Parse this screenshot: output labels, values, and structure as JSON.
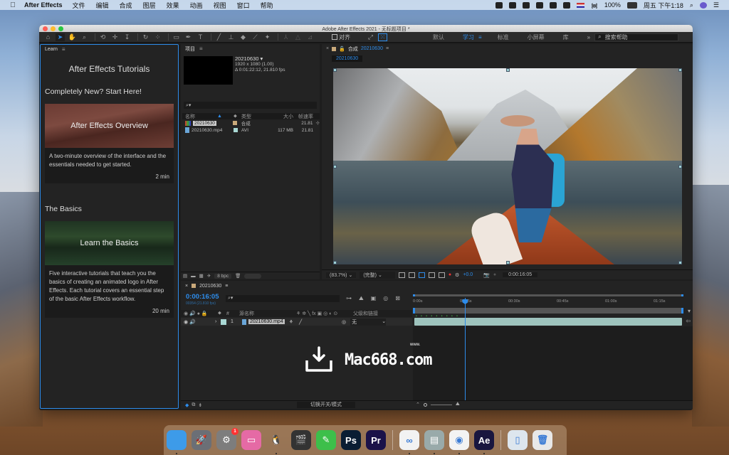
{
  "menubar": {
    "app_name": "After Effects",
    "items": [
      "文件",
      "编辑",
      "合成",
      "图层",
      "效果",
      "动画",
      "视图",
      "窗口",
      "帮助"
    ],
    "battery": "100%",
    "clock": "周五 下午1:18"
  },
  "window": {
    "title": "Adobe After Effects 2021 - 无标题项目 *"
  },
  "toolbar": {
    "snap_label": "对齐",
    "workspaces": [
      "默认",
      "学习",
      "标准",
      "小屏幕",
      "库"
    ],
    "active_workspace": "学习",
    "more": "»",
    "help_placeholder": "搜索帮助"
  },
  "learn": {
    "tab": "Learn",
    "title": "After Effects Tutorials",
    "sections": [
      {
        "heading": "Completely New? Start Here!",
        "card_title": "After Effects Overview",
        "description": "A two-minute overview of the interface and the essentials needed to get started.",
        "duration": "2 min"
      },
      {
        "heading": "The Basics",
        "card_title": "Learn the Basics",
        "description": "Five interactive tutorials that teach you the basics of creating an animated logo in After Effects. Each tutorial covers an essential step of the basic After Effects workflow.",
        "duration": "20 min"
      }
    ]
  },
  "project": {
    "tab": "项目",
    "preview": {
      "name": "20210630 ▾",
      "resolution": "1920 x 1080 (1.00)",
      "duration": "Δ 0:01:22:12, 21.810 fps"
    },
    "search_placeholder": "",
    "columns": [
      "名称",
      "类型",
      "大小",
      "帧速率"
    ],
    "rows": [
      {
        "name": "20210630",
        "type": "合成",
        "size": "",
        "fps": "21.81",
        "tag_color": "#c9a97a"
      },
      {
        "name": "20210630.mp4",
        "type": "AVI",
        "size": "117 MB",
        "fps": "21.81",
        "tag_color": "#a9d8d4"
      }
    ],
    "bpc": "8 bpc"
  },
  "composition": {
    "tab_prefix": "合成",
    "tab_name": "20210630",
    "flow_label": "20210630",
    "zoom": "(83.7%)",
    "resolution": "(完整)",
    "exposure": "+0.0",
    "timecode": "0:00:16:05"
  },
  "timeline": {
    "tab": "20210630",
    "timecode": "0:00:16:05",
    "frame_info": "00354 (21.810 fps)",
    "columns": {
      "num": "#",
      "source": "源名称",
      "parent": "父级和链接"
    },
    "layer": {
      "index": "1",
      "name": "20210630.mp4",
      "parent": "无"
    },
    "ruler": [
      "0:00s",
      "00:15s",
      "00:30s",
      "00:45s",
      "01:00s",
      "01:15s"
    ],
    "playhead_seconds": 16.2,
    "mode_label": "切换开关/模式"
  },
  "watermark": {
    "text": "Mac668.com",
    "www": "www."
  },
  "dock": {
    "apps": [
      {
        "name": "Finder",
        "label": "",
        "color": "#3d9be9"
      },
      {
        "name": "Launchpad",
        "label": "🚀",
        "color": "#6b6f76"
      },
      {
        "name": "System Preferences",
        "label": "⚙",
        "color": "#7d7d7d",
        "badge": "1"
      },
      {
        "name": "CleanMyMac",
        "label": "▭",
        "color": "#e56aa5"
      },
      {
        "name": "QQ",
        "label": "🐧",
        "color": "transparent"
      },
      {
        "name": "Final Cut Pro",
        "label": "🎬",
        "color": "#333"
      },
      {
        "name": "Pencil",
        "label": "✎",
        "color": "#3dbf4a"
      },
      {
        "name": "Photoshop",
        "label": "Ps",
        "color": "#0a1d33"
      },
      {
        "name": "Premiere Pro",
        "label": "Pr",
        "color": "#1b1249"
      },
      {
        "name": "Baidu Netdisk",
        "label": "∞",
        "color": "#f2f2f2"
      },
      {
        "name": "Disk Utility",
        "label": "▤",
        "color": "#9aa"
      },
      {
        "name": "Chrome",
        "label": "◉",
        "color": "#f3f3f3"
      },
      {
        "name": "After Effects",
        "label": "Ae",
        "color": "#19163f"
      },
      {
        "name": "Documents",
        "label": "▯",
        "color": "#dde6ee"
      },
      {
        "name": "Trash",
        "label": "🗑",
        "color": "#e8e8e8"
      }
    ]
  }
}
